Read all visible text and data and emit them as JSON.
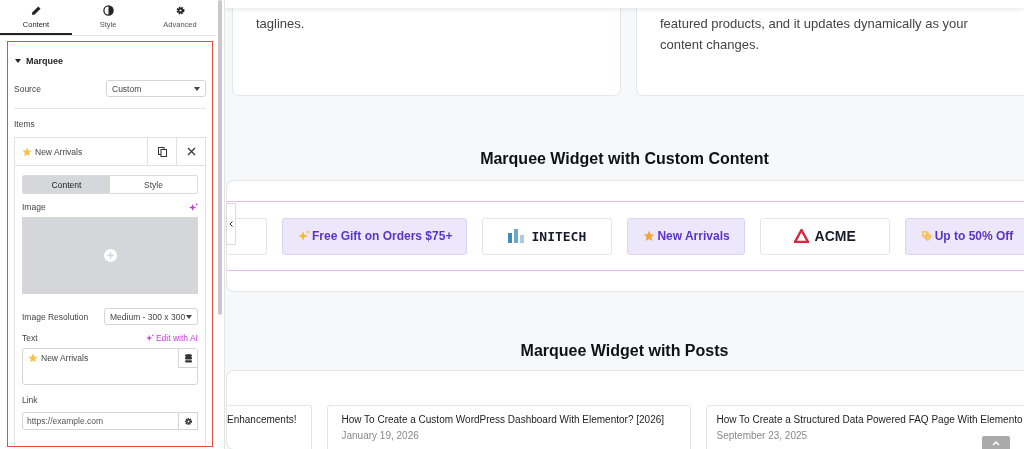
{
  "panel": {
    "tabs": [
      {
        "label": "Content",
        "selected": true
      },
      {
        "label": "Style",
        "selected": false
      },
      {
        "label": "Advanced",
        "selected": false
      }
    ],
    "section": {
      "title": "Marquee",
      "expanded": true
    },
    "source": {
      "label": "Source",
      "value": "Custom"
    },
    "items_label": "Items",
    "item": {
      "title": "New Arrivals",
      "subtabs": [
        {
          "label": "Content",
          "selected": true
        },
        {
          "label": "Style",
          "selected": false
        }
      ],
      "image_label": "Image",
      "resolution": {
        "label": "Image Resolution",
        "value": "Medium - 300 x 300"
      },
      "text_label": "Text",
      "ai_link": "Edit with AI",
      "text_value": "New Arrivals",
      "link_label": "Link",
      "link_placeholder": "https://example.com"
    }
  },
  "preview": {
    "cards": [
      {
        "lines": [
          "taglines."
        ]
      },
      {
        "lines": [
          "featured products, and it updates dynamically as your",
          "content changes."
        ]
      }
    ],
    "marquee_title": "Marquee Widget with Custom Content",
    "marquee_items": [
      {
        "kind": "cut"
      },
      {
        "kind": "badge",
        "text": "Free Gift on Orders $75+"
      },
      {
        "kind": "logo",
        "text": "INITECH"
      },
      {
        "kind": "badge",
        "text": "New Arrivals"
      },
      {
        "kind": "logo",
        "text": "ACME"
      },
      {
        "kind": "badge",
        "text": "Up to 50% Off"
      }
    ],
    "posts_title": "Marquee Widget with Posts",
    "posts": [
      {
        "kind": "partial",
        "title": "Enhancements!"
      },
      {
        "kind": "full",
        "title": "How To Create a Custom WordPress Dashboard With Elementor? [2026]",
        "date": "January 19, 2026"
      },
      {
        "kind": "full",
        "title": "How To Create a Structured Data Powered FAQ Page With Elemento",
        "date": "September 23, 2025"
      }
    ]
  }
}
